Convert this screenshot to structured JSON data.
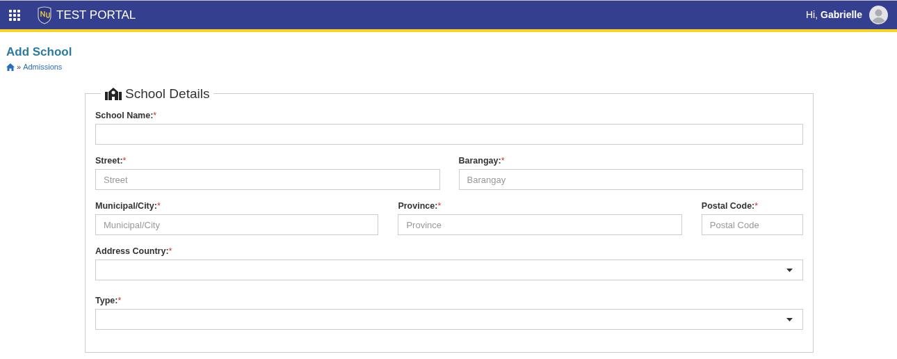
{
  "header": {
    "title": "TEST PORTAL",
    "greeting": "Hi,",
    "user_name": "Gabrielle"
  },
  "page": {
    "title": "Add School",
    "breadcrumb": [
      {
        "label": "Admissions"
      }
    ],
    "breadcrumb_separator": "»"
  },
  "section": {
    "title": "School Details",
    "rows": [
      [
        {
          "kind": "text",
          "label": "School Name:",
          "marker": "*"
        }
      ],
      [
        {
          "kind": "text",
          "label": "Street:",
          "marker": "*",
          "placeholder": "Street"
        },
        {
          "kind": "text",
          "label": "Barangay:",
          "marker": "*",
          "placeholder": "Barangay"
        }
      ],
      [
        {
          "kind": "text",
          "label": "Municipal/City:",
          "marker": "*",
          "placeholder": "Municipal/City"
        },
        {
          "kind": "text",
          "label": "Province:",
          "marker": "*",
          "placeholder": "Province"
        },
        {
          "kind": "text",
          "label": "Postal Code:",
          "marker": "*",
          "placeholder": "Postal Code"
        }
      ],
      [
        {
          "kind": "select",
          "label": "Address Country:",
          "marker": "*"
        }
      ],
      [
        {
          "kind": "select",
          "label": "Type:",
          "marker": "*"
        }
      ]
    ]
  }
}
